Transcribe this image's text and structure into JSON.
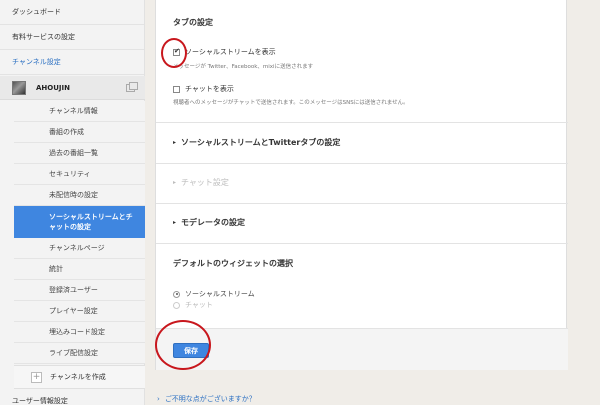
{
  "sidebar": {
    "dashboard": "ダッシュボード",
    "paid": "有料サービスの設定",
    "channel_settings": "チャンネル設定",
    "user_name": "AHOUJIN",
    "items": [
      {
        "label": "チャンネル情報"
      },
      {
        "label": "番組の作成"
      },
      {
        "label": "過去の番組一覧"
      },
      {
        "label": "セキュリティ"
      },
      {
        "label": "未配信時の設定"
      },
      {
        "label": "ソーシャルストリームとチ\nャットの設定"
      },
      {
        "label": "チャンネルページ"
      },
      {
        "label": "統計"
      },
      {
        "label": "登録済ユーザー"
      },
      {
        "label": "プレイヤー設定"
      },
      {
        "label": "埋込みコード設定"
      },
      {
        "label": "ライブ配信設定"
      }
    ],
    "create_channel": "チャンネルを作成",
    "user_info": "ユーザー情報設定"
  },
  "tab_settings": {
    "title": "タブの設定",
    "social_label": "ソーシャルストリームを表示",
    "social_checked": true,
    "social_desc": "メッセージが Twitter、Facebook、mixiに送信されます",
    "chat_label": "チャットを表示",
    "chat_checked": false,
    "chat_desc": "視聴者へのメッセージがチャットで送信されます。このメッセージはSNSには送信されません。"
  },
  "sections": {
    "social_twitter": "ソーシャルストリームとTwitterタブの設定",
    "chat": "チャット設定",
    "moderator": "モデレータの設定"
  },
  "default_widget": {
    "title": "デフォルトのウィジェットの選択",
    "options": [
      {
        "label": "ソーシャルストリーム",
        "selected": true
      },
      {
        "label": "チャット",
        "selected": false
      }
    ]
  },
  "save_label": "保存",
  "help_link": "ご不明な点がございますか？",
  "colors": {
    "accent": "#3f86e0",
    "annotation": "#c8171d"
  }
}
